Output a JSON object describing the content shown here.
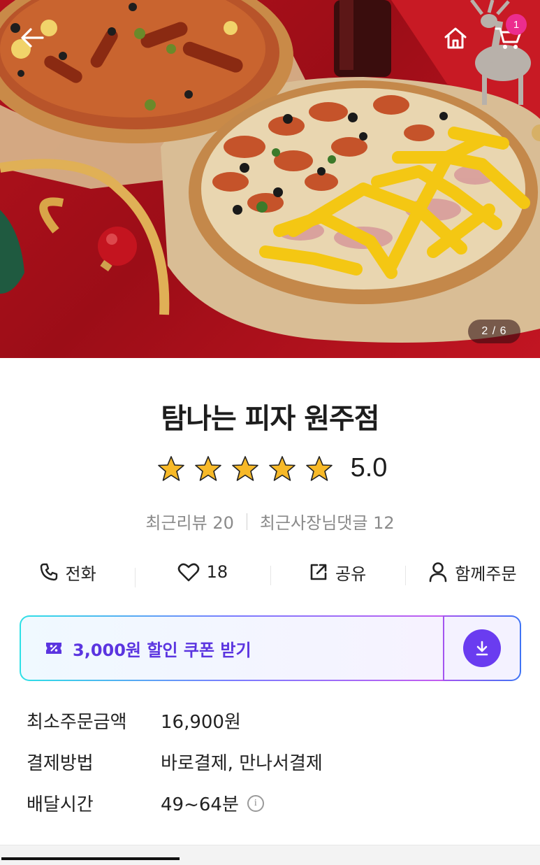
{
  "header": {
    "back_icon": "arrow-left-icon",
    "home_icon": "home-icon",
    "cart_icon": "cart-icon",
    "cart_count": "1"
  },
  "gallery": {
    "page_indicator": "2 / 6",
    "current": 2,
    "total": 6
  },
  "store": {
    "name": "탐나는 피자 원주점",
    "rating": "5.0",
    "stars": 5,
    "recent_reviews": "최근리뷰 20",
    "owner_comments": "최근사장님댓글 12"
  },
  "actions": [
    {
      "icon": "phone-icon",
      "label": "전화"
    },
    {
      "icon": "heart-icon",
      "label": "18"
    },
    {
      "icon": "share-icon",
      "label": "공유"
    },
    {
      "icon": "person-icon",
      "label": "함께주문"
    }
  ],
  "coupon": {
    "label": "3,000원 할인 쿠폰 받기",
    "icon": "coupon-icon",
    "download_icon": "download-icon",
    "colors": {
      "text": "#5b35e0",
      "button": "#6a3cf0"
    }
  },
  "info": [
    {
      "label": "최소주문금액",
      "value": "16,900원"
    },
    {
      "label": "결제방법",
      "value": "바로결제, 만나서결제"
    },
    {
      "label": "배달시간",
      "value": "49~64분"
    }
  ],
  "info_icon": "info-icon"
}
